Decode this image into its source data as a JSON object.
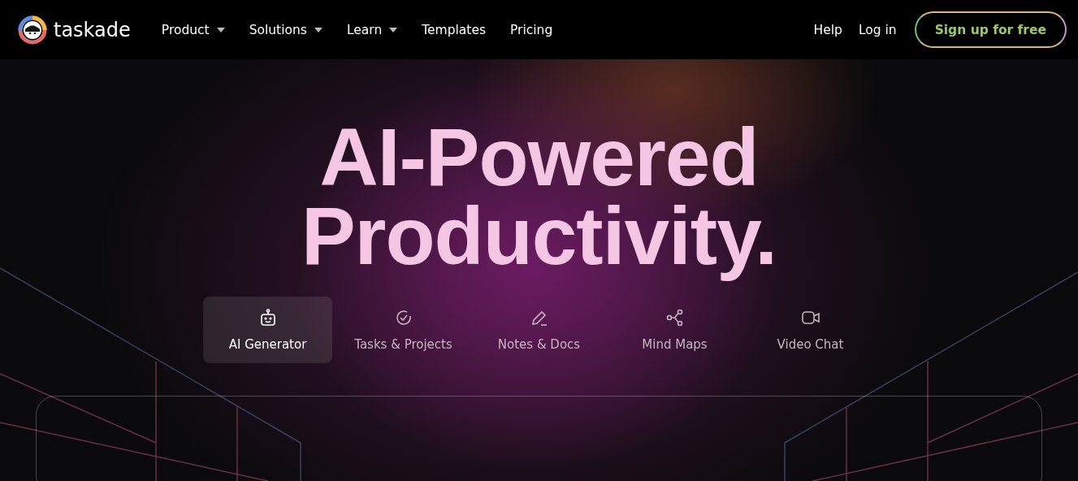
{
  "header": {
    "logo_text": "taskade",
    "nav": [
      {
        "label": "Product",
        "dropdown": true
      },
      {
        "label": "Solutions",
        "dropdown": true
      },
      {
        "label": "Learn",
        "dropdown": true
      },
      {
        "label": "Templates",
        "dropdown": false
      },
      {
        "label": "Pricing",
        "dropdown": false
      }
    ],
    "right_links": [
      "Help",
      "Log in"
    ],
    "signup_button": "Sign up for free"
  },
  "hero": {
    "title_lines": [
      "AI-Powered",
      "Productivity."
    ]
  },
  "tabs": [
    {
      "label": "AI Generator",
      "kind": "robot",
      "selected": true
    },
    {
      "label": "Tasks & Projects",
      "kind": "check",
      "selected": false
    },
    {
      "label": "Notes & Docs",
      "kind": "pen",
      "selected": false
    },
    {
      "label": "Mind Maps",
      "kind": "nodes",
      "selected": false
    },
    {
      "label": "Video Chat",
      "kind": "video",
      "selected": false
    }
  ]
}
